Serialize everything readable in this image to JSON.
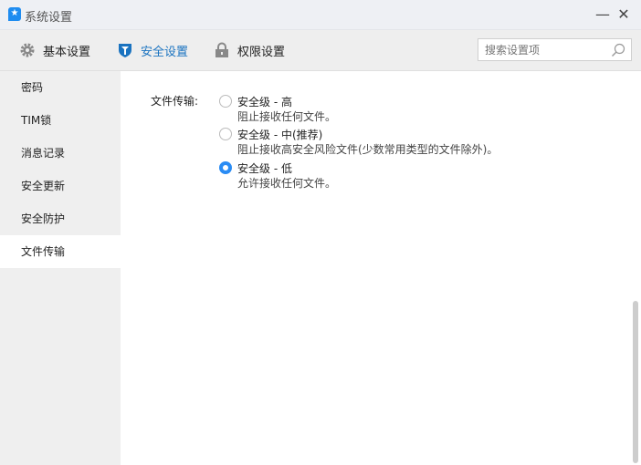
{
  "window": {
    "title": "系统设置",
    "minimize": "—",
    "close": "✕"
  },
  "tabs": [
    {
      "label": "基本设置",
      "icon": "gear-icon"
    },
    {
      "label": "安全设置",
      "icon": "shield-icon"
    },
    {
      "label": "权限设置",
      "icon": "lock-icon"
    }
  ],
  "search": {
    "placeholder": "搜索设置项"
  },
  "sidebar": {
    "items": [
      {
        "label": "密码"
      },
      {
        "label": "TIM锁"
      },
      {
        "label": "消息记录"
      },
      {
        "label": "安全更新"
      },
      {
        "label": "安全防护"
      },
      {
        "label": "文件传输"
      }
    ]
  },
  "file_transfer": {
    "label": "文件传输:",
    "options": [
      {
        "title": "安全级 - 高",
        "desc": "阻止接收任何文件。",
        "selected": false
      },
      {
        "title": "安全级 - 中(推荐)",
        "desc": "阻止接收高安全风险文件(少数常用类型的文件除外)。",
        "selected": false
      },
      {
        "title": "安全级 - 低",
        "desc": "允许接收任何文件。",
        "selected": true
      }
    ]
  },
  "colors": {
    "accent": "#1a73c0",
    "radio": "#2a8cf4"
  }
}
